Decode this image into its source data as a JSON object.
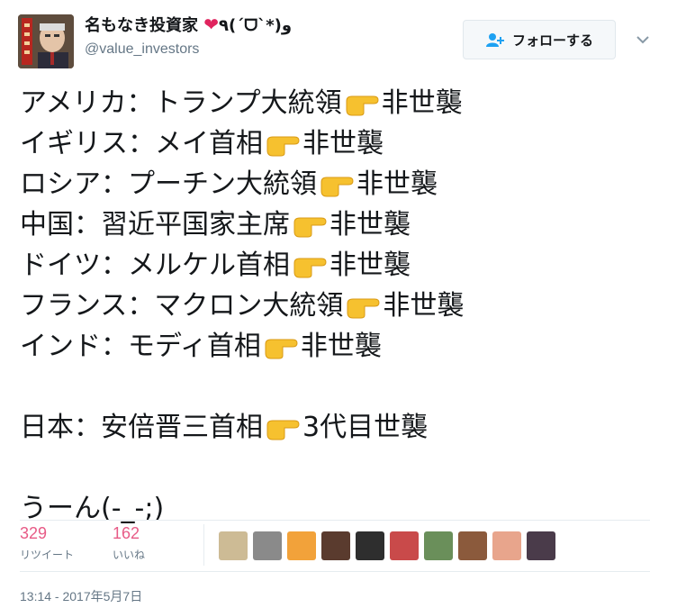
{
  "author": {
    "display_name": "名もなき投資家",
    "emoji": "❤",
    "kaomoji": "٩(ˊᗜˋ*)و",
    "handle": "@value_investors"
  },
  "follow_button": {
    "label": "フォローする"
  },
  "tweet": {
    "lines": [
      {
        "left": "アメリカ：トランプ大統領",
        "right": "非世襲"
      },
      {
        "left": "イギリス：メイ首相",
        "right": "非世襲"
      },
      {
        "left": "ロシア：プーチン大統領",
        "right": "非世襲"
      },
      {
        "left": "中国：習近平国家主席",
        "right": "非世襲"
      },
      {
        "left": "ドイツ：メルケル首相",
        "right": "非世襲"
      },
      {
        "left": "フランス：マクロン大統領",
        "right": "非世襲"
      },
      {
        "left": "インド：モディ首相",
        "right": "非世襲"
      }
    ],
    "japan": {
      "left": "日本：安倍晋三首相",
      "right": "3代目世襲"
    },
    "closing": "うーん(-_-;)"
  },
  "stats": {
    "retweets": {
      "value": "329",
      "label": "リツイート"
    },
    "likes": {
      "value": "162",
      "label": "いいね"
    }
  },
  "liker_colors": [
    "#cdbb95",
    "#8a8a8a",
    "#f2a23a",
    "#5a3b2e",
    "#2e2e2e",
    "#c94a4a",
    "#6a8f5a",
    "#8b5a3c",
    "#e8a58c",
    "#4a3b4a"
  ],
  "timestamp": "13:14 - 2017年5月7日",
  "accent_colors": {
    "like": "#e0245e",
    "link": "#1da1f2",
    "text": "#14171a",
    "muted": "#657786"
  }
}
